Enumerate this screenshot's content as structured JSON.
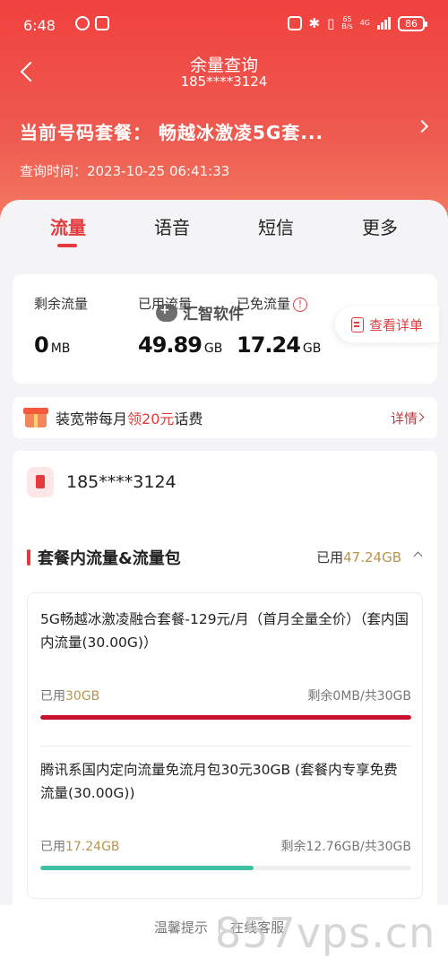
{
  "status_bar": {
    "time": "6:48",
    "net_speed": "65\nB/s",
    "net_type": "4G",
    "battery": "86"
  },
  "nav": {
    "title": "余量查询",
    "subtitle": "185****3124"
  },
  "plan": {
    "label": "当前号码套餐：  畅越冰激凌5G套..."
  },
  "query_time": "查询时间：2023-10-25 06:41:33",
  "tabs": [
    "流量",
    "语音",
    "短信",
    "更多"
  ],
  "active_tab": 0,
  "summary": {
    "remaining_label": "剩余流量",
    "remaining_value": "0",
    "remaining_unit": "MB",
    "used_label": "已用流量",
    "used_value": "49.89",
    "used_unit": "GB",
    "free_label": "已免流量",
    "free_value": "17.24",
    "free_unit": "GB",
    "detail_button": "查看详单"
  },
  "watermark": "汇智软件",
  "promo": {
    "text_a": "装宽带每月",
    "text_b": "领20元",
    "text_c": "话费",
    "more": "详情"
  },
  "account": {
    "number": "185****3124"
  },
  "section": {
    "title": "套餐内流量&流量包",
    "used_prefix": "已用",
    "used_value": "47.24GB"
  },
  "packages": [
    {
      "name": "5G畅越冰激凌融合套餐-129元/月（首月全量全价）（套内国内流量(30.00G)）",
      "used_prefix": "已用",
      "used_value": "30GB",
      "remaining": "剩余0MB/共30GB",
      "progress": 1.0,
      "bar_color": "#c8102e"
    },
    {
      "name": "腾讯系国内定向流量免流月包30元30GB (套餐内专享免费流量(30.00G))",
      "used_prefix": "已用",
      "used_value": "17.24GB",
      "remaining": "剩余12.76GB/共30GB",
      "progress": 0.575,
      "bar_color": "#3fc2a2"
    }
  ],
  "footer": {
    "tip": "温馨提示",
    "service": "在线客服"
  },
  "site_watermark": "857vps.cn",
  "colors": {
    "accent": "#e43a3d",
    "header": "#f0413f",
    "gold": "#b7954d"
  }
}
